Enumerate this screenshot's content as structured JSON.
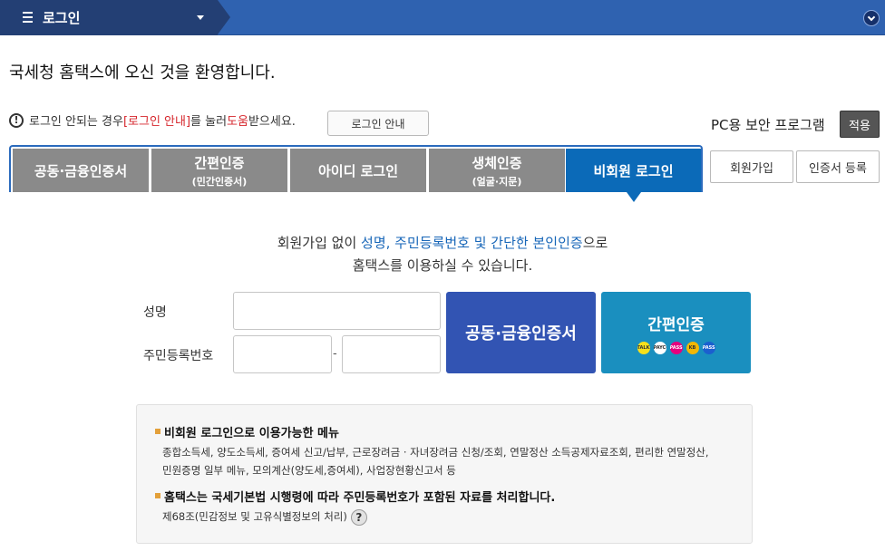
{
  "header": {
    "menu_title": "로그인"
  },
  "welcome": "국세청 홈택스에 오신 것을 환영합니다.",
  "notice": {
    "icon_text": "!",
    "prefix": "로그인 안되는 경우 ",
    "link": "[로그인 안내]",
    "middle": "를 눌러 ",
    "help_word": "도움",
    "suffix": "받으세요.",
    "button": "로그인 안내"
  },
  "security": {
    "label": "PC용 보안 프로그램",
    "apply_button": "적용"
  },
  "tabs": [
    {
      "label": "공동·금융인증서",
      "sub": ""
    },
    {
      "label": "간편인증",
      "sub": "(민간인증서)"
    },
    {
      "label": "아이디 로그인",
      "sub": ""
    },
    {
      "label": "생체인증",
      "sub": "(얼굴·지문)"
    },
    {
      "label": "비회원 로그인",
      "sub": "",
      "active": true
    }
  ],
  "side_buttons": {
    "signup": "회원가입",
    "cert_register": "인증서 등록"
  },
  "intro": {
    "line1_pre": "회원가입 없이 ",
    "line1_highlight": "성명, 주민등록번호 및 간단한 본인인증",
    "line1_post": "으로",
    "line2": "홈택스를 이용하실 수 있습니다."
  },
  "form": {
    "name_label": "성명",
    "rrn_label": "주민등록번호",
    "dash": "-",
    "cert_button": "공동·금융인증서",
    "simple_button": "간편인증",
    "simple_icons": [
      {
        "name": "kakao-icon",
        "text": "TALK",
        "color": "#f7e01b"
      },
      {
        "name": "payco-icon",
        "text": "PAYCO",
        "color": "#ffffff"
      },
      {
        "name": "pass-icon",
        "text": "PASS",
        "color": "#e6007e"
      },
      {
        "name": "kb-icon",
        "text": "KB",
        "color": "#f2b705"
      },
      {
        "name": "pass-blue-icon",
        "text": "PASS",
        "color": "#1b5fcf"
      }
    ]
  },
  "info": {
    "head1": "비회원 로그인으로 이용가능한 메뉴",
    "body1_line1": "종합소득세, 양도소득세, 증여세 신고/납부, 근로장려금 · 자녀장려금 신청/조회, 연말정산 소득공제자료조회, 편리한 연말정산,",
    "body1_line2": "민원증명 일부 메뉴, 모의계산(양도세,증여세), 사업장현황신고서 등",
    "head2": "홈택스는 국세기본법 시행령에 따라 주민등록번호가 포함된 자료를 처리합니다.",
    "body2": "제68조(민감정보 및 고유식별정보의 처리)",
    "help": "?"
  }
}
